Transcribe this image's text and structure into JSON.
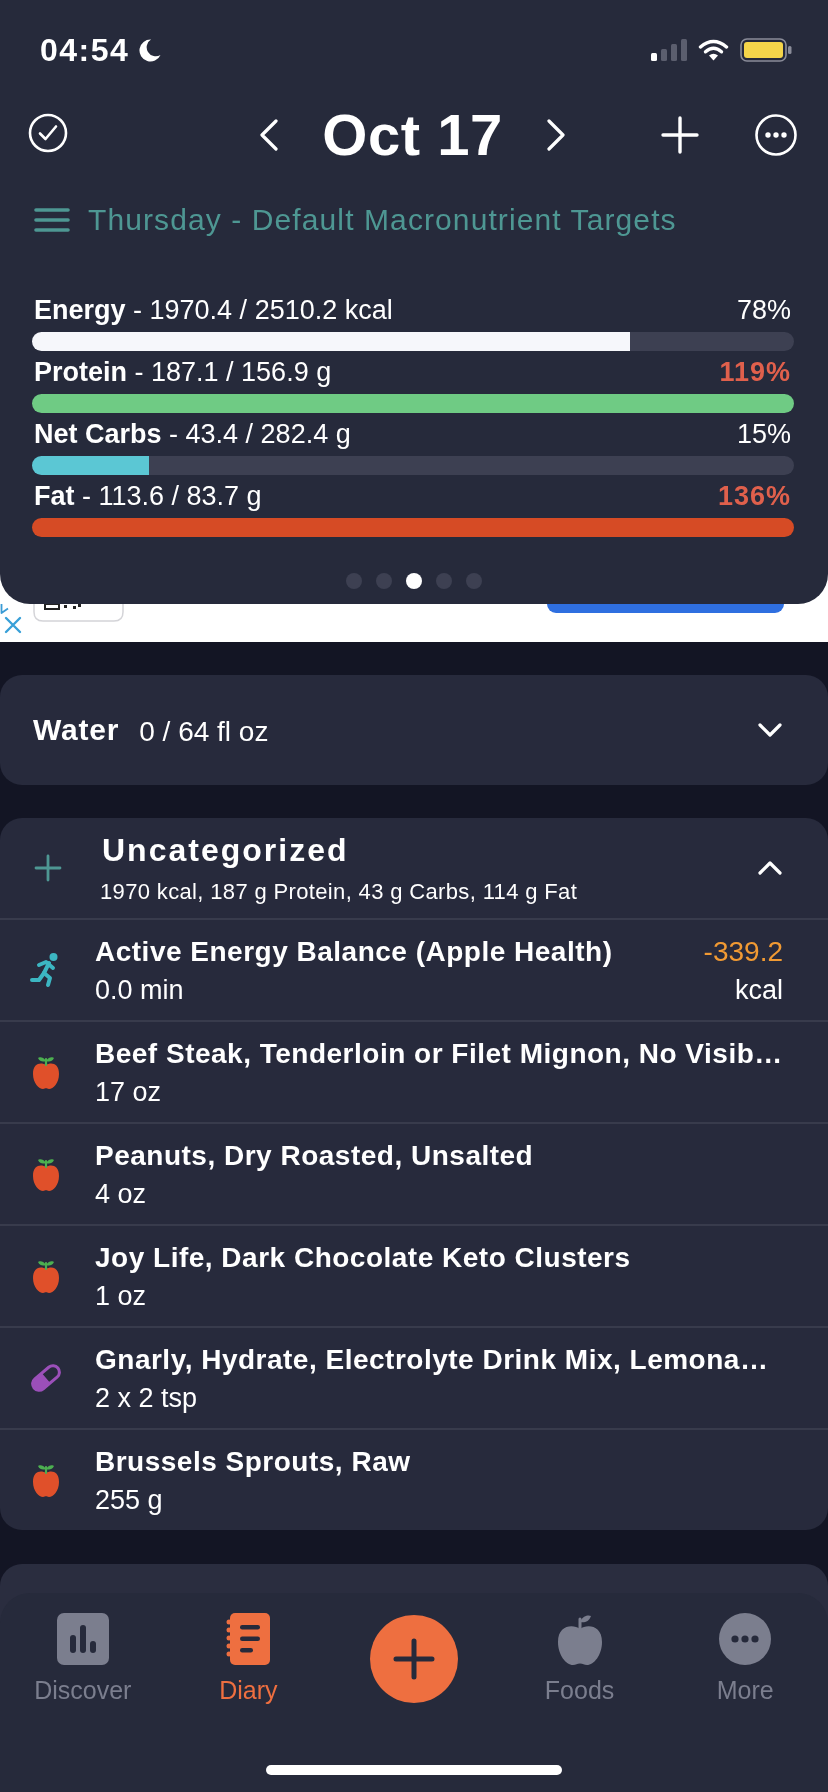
{
  "status_bar": {
    "time": "04:54"
  },
  "header": {
    "date": "Oct 17",
    "target_label": "Thursday - Default Macronutrient Targets"
  },
  "macros": [
    {
      "label": "**Energy** - 1970.4 / 2510.2 kcal",
      "percent": "78%",
      "over": false,
      "level": 0.785,
      "color": "#f6f7fb"
    },
    {
      "label": "**Protein** - 187.1 / 156.9 g",
      "percent": "119%",
      "over": true,
      "level": 1,
      "color": "#6fcb84"
    },
    {
      "label": "**Net Carbs** - 43.4 / 282.4 g",
      "percent": "15%",
      "over": false,
      "level": 0.153,
      "color": "#5bc7d4"
    },
    {
      "label": "**Fat** - 113.6 / 83.7 g",
      "percent": "136%",
      "over": true,
      "level": 1,
      "color": "#d64b25"
    }
  ],
  "pager": [
    {
      "selected": false
    },
    {
      "selected": false
    },
    {
      "selected": true
    },
    {
      "selected": false
    },
    {
      "selected": false
    }
  ],
  "water": {
    "title": "Water",
    "amount": "0 / 64 fl oz",
    "expanded": false
  },
  "meal": {
    "title": "Uncategorized",
    "summary": "1970 kcal, 187 g Protein, 43 g Carbs, 114 g Fat",
    "expanded": true,
    "entries": [
      {
        "kind": "activity",
        "name": "Active Energy Balance (Apple Health)",
        "amount": "0.0 min",
        "value": "-339.2",
        "unit": "kcal"
      },
      {
        "kind": "food",
        "name": "Beef Steak, Tenderloin or Filet Mignon, No Visib…",
        "amount": "17 oz"
      },
      {
        "kind": "food",
        "name": "Peanuts, Dry Roasted, Unsalted",
        "amount": "4 oz"
      },
      {
        "kind": "food",
        "name": "Joy Life, Dark Chocolate Keto Clusters",
        "amount": "1 oz"
      },
      {
        "kind": "supplement",
        "name": "Gnarly, Hydrate, Electrolyte Drink Mix, Lemona…",
        "amount": "2 x 2 tsp"
      },
      {
        "kind": "food",
        "name": "Brussels Sprouts, Raw",
        "amount": "255 g"
      }
    ]
  },
  "tabs": [
    {
      "kind": "discover",
      "label": "Discover",
      "selected": false
    },
    {
      "kind": "diary",
      "label": "Diary",
      "selected": true
    },
    {
      "kind": "foods",
      "label": "Foods",
      "selected": false
    },
    {
      "kind": "more",
      "label": "More",
      "selected": false
    }
  ]
}
